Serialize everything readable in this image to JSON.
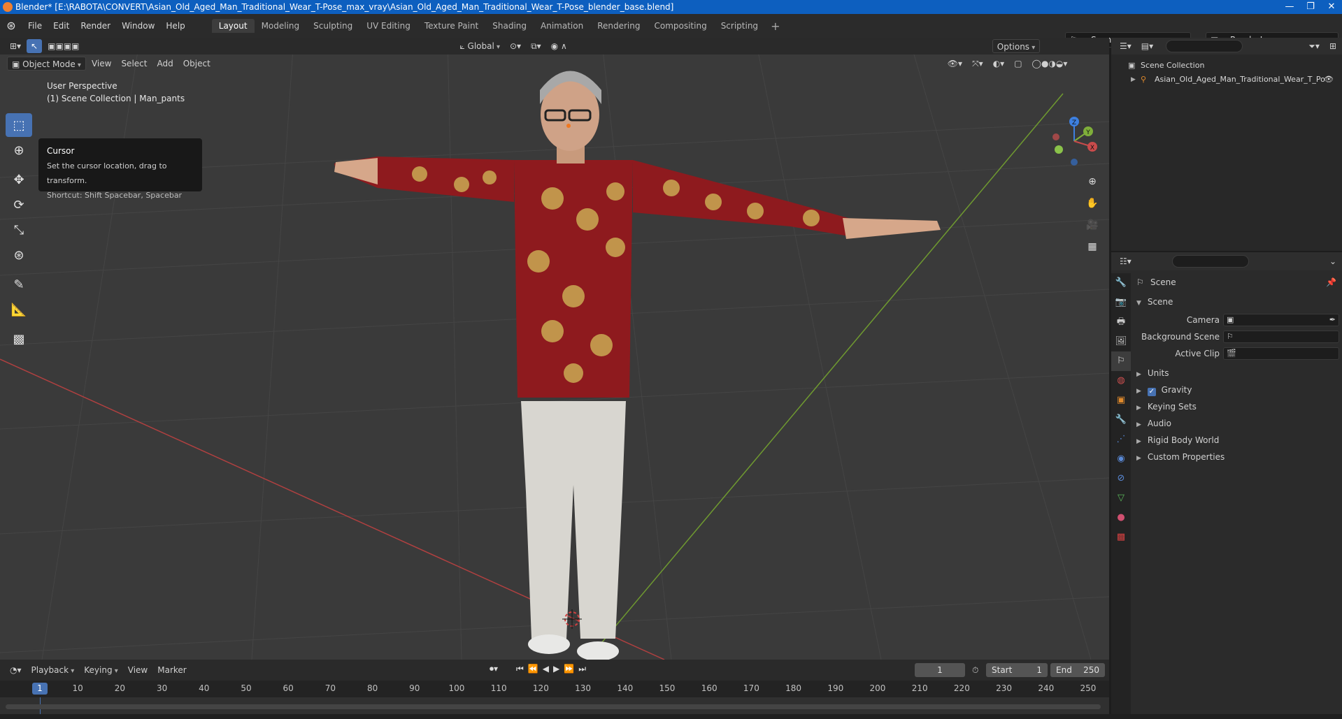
{
  "window": {
    "title": "Blender* [E:\\RABOTA\\CONVERT\\Asian_Old_Aged_Man_Traditional_Wear_T-Pose_max_vray\\Asian_Old_Aged_Man_Traditional_Wear_T-Pose_blender_base.blend]",
    "minimize": "—",
    "maximize": "❐",
    "close": "✕"
  },
  "menubar": {
    "items": [
      "File",
      "Edit",
      "Render",
      "Window",
      "Help"
    ]
  },
  "workspaces": [
    "Layout",
    "Modeling",
    "Sculpting",
    "UV Editing",
    "Texture Paint",
    "Shading",
    "Animation",
    "Rendering",
    "Compositing",
    "Scripting"
  ],
  "active_workspace": "Layout",
  "scene_selector": "Scene",
  "render_layer": "RenderLayer",
  "viewport": {
    "transform_orientation": "Global",
    "options_label": "Options",
    "mode": "Object Mode",
    "menus": [
      "View",
      "Select",
      "Add",
      "Object"
    ],
    "perspective": "User Perspective",
    "collection_info": "(1) Scene Collection | Man_pants"
  },
  "tooltip": {
    "title": "Cursor",
    "description": "Set the cursor location, drag to transform.",
    "shortcut": "Shortcut: Shift Spacebar, Spacebar"
  },
  "gizmo": {
    "z": "Z",
    "y": "Y",
    "x": "X"
  },
  "timeline": {
    "menus": [
      "Playback",
      "Keying",
      "View",
      "Marker"
    ],
    "current_frame": "1",
    "start_label": "Start",
    "start_value": "1",
    "end_label": "End",
    "end_value": "250",
    "ticks": [
      "1",
      "10",
      "20",
      "30",
      "40",
      "50",
      "60",
      "70",
      "80",
      "90",
      "100",
      "110",
      "120",
      "130",
      "140",
      "150",
      "160",
      "170",
      "180",
      "190",
      "200",
      "210",
      "220",
      "230",
      "240",
      "250"
    ]
  },
  "outliner": {
    "root": "Scene Collection",
    "items": [
      "Asian_Old_Aged_Man_Traditional_Wear_T_Po"
    ]
  },
  "properties": {
    "context_title": "Scene",
    "panel_title": "Scene",
    "fields": [
      {
        "label": "Camera",
        "value": ""
      },
      {
        "label": "Background Scene",
        "value": ""
      },
      {
        "label": "Active Clip",
        "value": ""
      }
    ],
    "panels": [
      "Units",
      "Gravity",
      "Keying Sets",
      "Audio",
      "Rigid Body World",
      "Custom Properties"
    ],
    "gravity_checked": true
  },
  "colors": {
    "accent": "#4772b3",
    "title_bar": "#0d5fbf",
    "viewport_bg": "#3a3a3a",
    "x_axis": "#c94b4b",
    "y_axis": "#7fae3a",
    "z_axis": "#3d80e0"
  }
}
